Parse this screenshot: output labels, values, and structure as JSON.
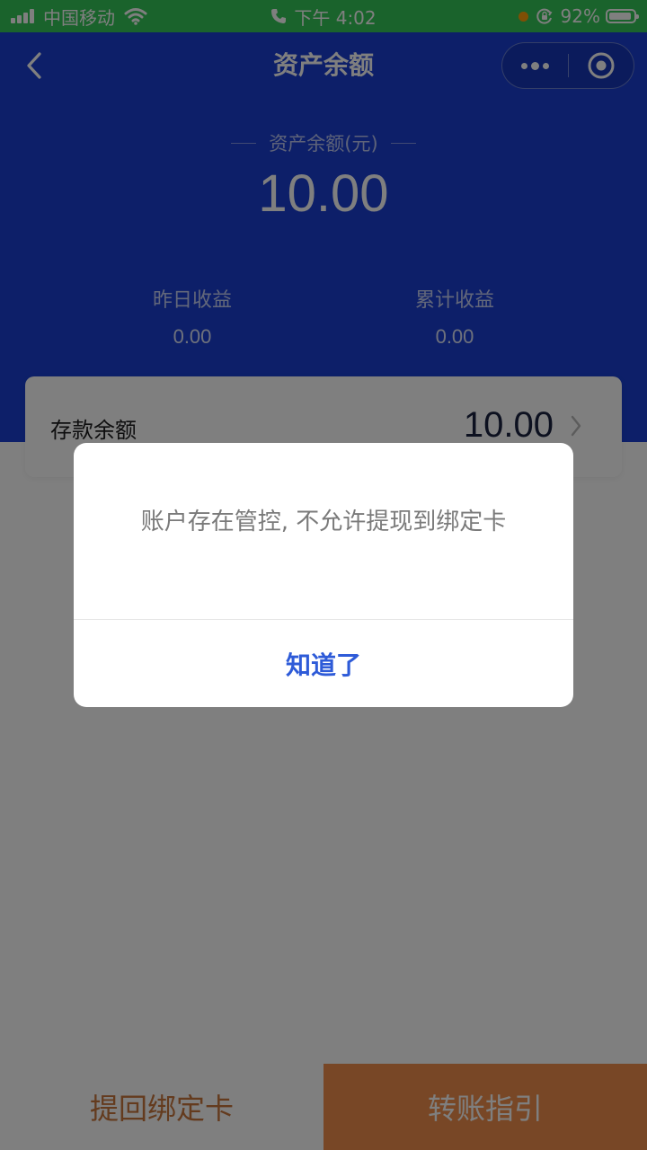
{
  "status_bar": {
    "carrier": "中国移动",
    "time": "下午 4:02",
    "battery": "92%",
    "battery_level": 0.92
  },
  "nav": {
    "title": "资产余额"
  },
  "balance": {
    "label": "资产余额(元)",
    "value": "10.00"
  },
  "stats": {
    "yesterday_label": "昨日收益",
    "yesterday_value": "0.00",
    "total_label": "累计收益",
    "total_value": "0.00"
  },
  "deposit": {
    "label": "存款余额",
    "value": "10.00"
  },
  "buttons": {
    "withdraw_bound_card": "提回绑定卡",
    "transfer_guide": "转账指引"
  },
  "dialog": {
    "message": "账户存在管控, 不允许提现到绑定卡",
    "confirm": "知道了"
  },
  "colors": {
    "status_bar": "#35c759",
    "brand_blue": "#1a3fd2",
    "accent_orange": "#f08f4c",
    "dialog_button": "#2e5bd8"
  },
  "icons": [
    "signal-icon",
    "wifi-icon",
    "phone-icon",
    "rotation-lock-icon",
    "battery-icon",
    "back-icon",
    "more-icon",
    "close-miniprogram-icon",
    "chevron-right-icon"
  ]
}
